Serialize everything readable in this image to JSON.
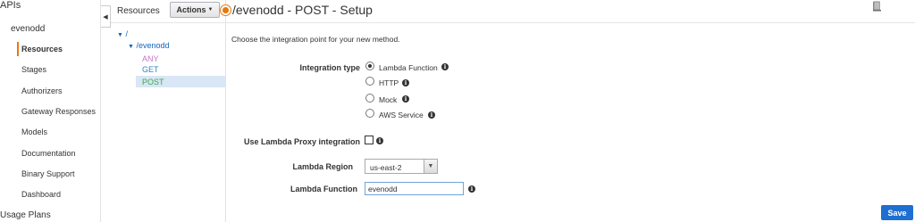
{
  "leftnav": {
    "root_label": "APIs",
    "api_name": "evenodd",
    "items": [
      {
        "label": "Resources",
        "active": true
      },
      {
        "label": "Stages"
      },
      {
        "label": "Authorizers"
      },
      {
        "label": "Gateway Responses"
      },
      {
        "label": "Models"
      },
      {
        "label": "Documentation"
      },
      {
        "label": "Binary Support"
      },
      {
        "label": "Dashboard"
      }
    ],
    "usage_plans": "Usage Plans"
  },
  "resources": {
    "title": "Resources",
    "actions_label": "Actions",
    "tree": {
      "root": "/",
      "child": "/evenodd",
      "methods": [
        "ANY",
        "GET",
        "POST"
      ]
    }
  },
  "main": {
    "title": "/evenodd - POST - Setup",
    "intro": "Choose the integration point for your new method.",
    "integration_type_label": "Integration type",
    "options": [
      "Lambda Function",
      "HTTP",
      "Mock",
      "AWS Service"
    ],
    "selected_option": "Lambda Function",
    "proxy_label": "Use Lambda Proxy integration",
    "region_label": "Lambda Region",
    "region_value": "us-east-2",
    "function_label": "Lambda Function",
    "function_value": "evenodd",
    "save_label": "Save"
  },
  "colors": {
    "accent_orange": "#e47911",
    "link_blue": "#1166bb",
    "save_blue": "#1e6fd1",
    "selected_row": "#d8e6f5"
  }
}
